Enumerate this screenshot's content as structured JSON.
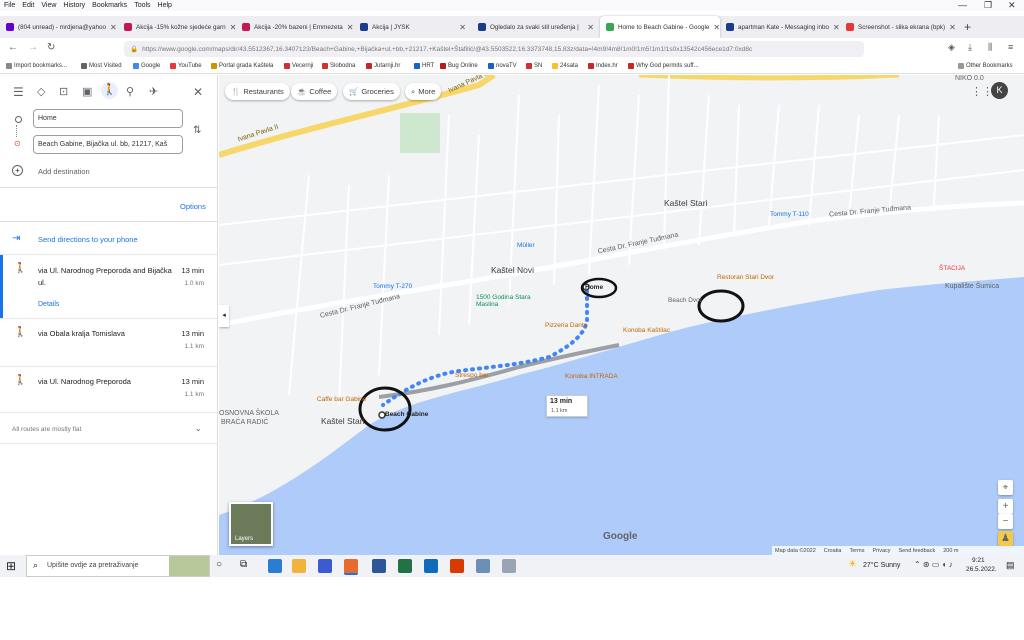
{
  "menu": [
    "File",
    "Edit",
    "View",
    "History",
    "Bookmarks",
    "Tools",
    "Help"
  ],
  "tabs": [
    {
      "title": "(804 unread) - mrdjena@yahoo",
      "color": "#6001d2"
    },
    {
      "title": "Akcija -15% kožne sjedeće garn",
      "color": "#c2185b"
    },
    {
      "title": "Akcija -20% bazeni | Emmezeta",
      "color": "#c2185b"
    },
    {
      "title": "Akcija | JYSK",
      "color": "#1a3c8c"
    },
    {
      "title": "Ogledalo za svaki stil uređenja |",
      "color": "#1a3c8c"
    },
    {
      "title": "Home to Beach Gabine - Google",
      "color": "#34a853"
    },
    {
      "title": "apartman Kate - Messaging inbo",
      "color": "#1a3c8c"
    },
    {
      "title": "Screenshot - slika ekrana (bpk)",
      "color": "#e53935"
    }
  ],
  "url": "https://www.google.com/maps/dir/43.5512367,16.3407123/Beach+Gabine,+Bijačka+ul.+bb,+21217,+Kaštel+Štafilić/@43.5503522,16.3373748,15.83z/data=!4m9!4m8!1m0!1m5!1m1!1s0x13542c456ece1d7:0xd8c",
  "bookmarks": [
    {
      "label": "Import bookmarks...",
      "color": "#888"
    },
    {
      "label": "Most Visited",
      "color": "#666"
    },
    {
      "label": "Google",
      "color": "#4285f4"
    },
    {
      "label": "YouTube",
      "color": "#e53935"
    },
    {
      "label": "Portal grada Kaštela",
      "color": "#c49a00"
    },
    {
      "label": "Vecernji",
      "color": "#d32f2f"
    },
    {
      "label": "Slobodna",
      "color": "#d32f2f"
    },
    {
      "label": "Jutarnji.hr",
      "color": "#c62828"
    },
    {
      "label": "HRT",
      "color": "#1565c0"
    },
    {
      "label": "Bug Online",
      "color": "#b71c1c"
    },
    {
      "label": "novaTV",
      "color": "#1565c0"
    },
    {
      "label": "SN",
      "color": "#d32f2f"
    },
    {
      "label": "24sata",
      "color": "#fbc02d"
    },
    {
      "label": "Index.hr",
      "color": "#c62828"
    },
    {
      "label": "Why God permits suff...",
      "color": "#c62828"
    }
  ],
  "other_bookmarks": "Other Bookmarks",
  "directions": {
    "from": "Home",
    "to": "Beach Gabine, Bijačka ul. bb, 21217, Kaš",
    "add_destination": "Add destination",
    "options": "Options",
    "send_to_phone": "Send directions to your phone",
    "routes": [
      {
        "via": "via Ul. Narodnog Preporoda and Bijačka ul.",
        "time": "13 min",
        "dist": "1.0 km",
        "details": "Details"
      },
      {
        "via": "via Obala kralja Tomislava",
        "time": "13 min",
        "dist": "1.1 km"
      },
      {
        "via": "via Ul. Narodnog Preporoda",
        "time": "13 min",
        "dist": "1.1 km"
      }
    ],
    "flat_note": "All routes are mostly flat"
  },
  "map": {
    "chips": [
      "Restaurants",
      "Coffee",
      "Groceries",
      "More"
    ],
    "avatar": "K",
    "labels": {
      "kastel_novi": "Kaštel Novi",
      "kastel_stari_n": "Kaštel Stari",
      "kastel_stari_s": "Kaštel Stari",
      "road1": "Cesta Dr. Franje Tuđmana",
      "road2": "Cesta Dr. Franje Tuđmana",
      "road3": "Cesta Dr. Franje Tuđmana",
      "ivana_pavla": "Ivana Pavla II",
      "ivana_pavla2": "Ivana Pavla II",
      "school": "OSNOVNA ŠKOLA",
      "school2": "BRAĆA RADIĆ",
      "kupaliste": "Kupalište Šumica",
      "niko": "NIKO 0.0"
    },
    "pois": {
      "home": "Home",
      "beach_gabine": "Beach Gabine",
      "caffe_gabine": "Caffe bar Gabine",
      "muller": "Müller",
      "tommy270": "Tommy T-270",
      "tommy110": "Tommy T-110",
      "godina": "1500 Godina Stara Maslina",
      "dante": "Pizzeria Dante",
      "kastilac": "Konoba Kaštilac",
      "intrada": "Konoba INTRADA",
      "bar": "Strespo bar",
      "dvor": "Restoran Stari Dvor",
      "beach_dvor": "Beach Dvor",
      "stacija": "ŠTACIJA"
    },
    "route_time": "13 min",
    "route_dist": "1.1 km",
    "layers": "Layers",
    "footer": [
      "Map data ©2022",
      "Croatia",
      "Terms",
      "Privacy",
      "Send feedback",
      "200 m"
    ],
    "brand": "Google"
  },
  "taskbar": {
    "search_placeholder": "Upišite ovdje za pretraživanje",
    "weather": "27°C  Sunny",
    "time": "9:21",
    "date": "26.5.2022."
  }
}
